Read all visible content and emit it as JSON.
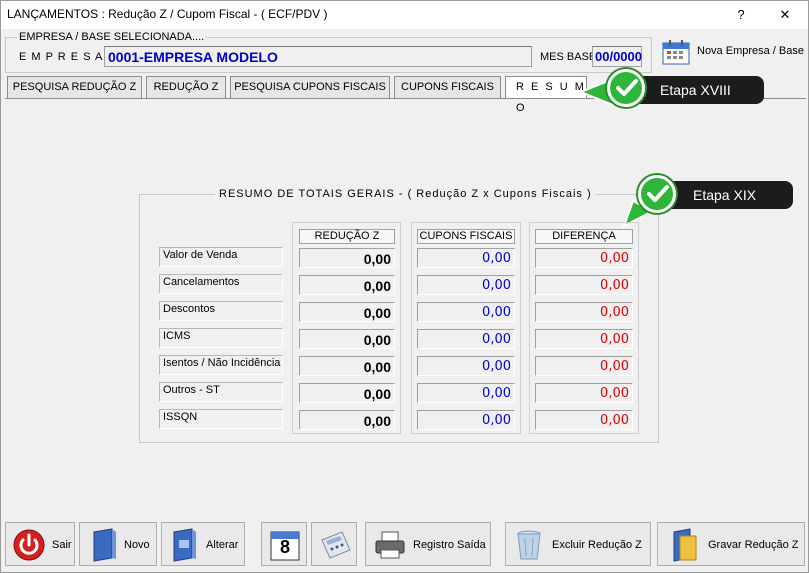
{
  "window": {
    "title": "LANÇAMENTOS : Redução Z / Cupom Fiscal - ( ECF/PDV )",
    "help_label": "?",
    "close_label": "✕"
  },
  "header": {
    "group_label": "EMPRESA  /  BASE  SELECIONADA....",
    "empresa_label": "E M P R E S A",
    "empresa_value": "0001-EMPRESA MODELO",
    "mes_base_label": "MES BASE",
    "mes_base_value": "00/0000",
    "nova_empresa_label": "Nova Empresa / Base"
  },
  "tabs": [
    {
      "label": "PESQUISA REDUÇÃO Z"
    },
    {
      "label": "REDUÇÃO Z"
    },
    {
      "label": "PESQUISA CUPONS FISCAIS"
    },
    {
      "label": "CUPONS FISCAIS"
    },
    {
      "label": "R E S U M O"
    }
  ],
  "callouts": {
    "etapa1": "Etapa XVIII",
    "etapa2": "Etapa XIX"
  },
  "resumo": {
    "title": "RESUMO  DE  TOTAIS  GERAIS  -  ( Redução Z x Cupons Fiscais )",
    "columns": [
      "REDUÇÃO Z",
      "CUPONS FISCAIS",
      "DIFERENÇA"
    ],
    "rows": [
      {
        "label": "Valor de Venda",
        "reducao": "0,00",
        "cupons": "0,00",
        "diferenca": "0,00"
      },
      {
        "label": "Cancelamentos",
        "reducao": "0,00",
        "cupons": "0,00",
        "diferenca": "0,00"
      },
      {
        "label": "Descontos",
        "reducao": "0,00",
        "cupons": "0,00",
        "diferenca": "0,00"
      },
      {
        "label": "ICMS",
        "reducao": "0,00",
        "cupons": "0,00",
        "diferenca": "0,00"
      },
      {
        "label": "Isentos / Não Incidência",
        "reducao": "0,00",
        "cupons": "0,00",
        "diferenca": "0,00"
      },
      {
        "label": "Outros - ST",
        "reducao": "0,00",
        "cupons": "0,00",
        "diferenca": "0,00"
      },
      {
        "label": "ISSQN",
        "reducao": "0,00",
        "cupons": "0,00",
        "diferenca": "0,00"
      }
    ]
  },
  "toolbar": {
    "sair": "Sair",
    "novo": "Novo",
    "alterar": "Alterar",
    "calendar_day": "8",
    "registro_saida": "Registro Saída",
    "excluir": "Excluir Redução Z",
    "gravar": "Gravar Redução Z"
  },
  "colors": {
    "empresa_text": "#0000c8",
    "positive_blue": "#0000d0",
    "difference_red": "#e00000",
    "callout_green": "#2fb63a"
  }
}
